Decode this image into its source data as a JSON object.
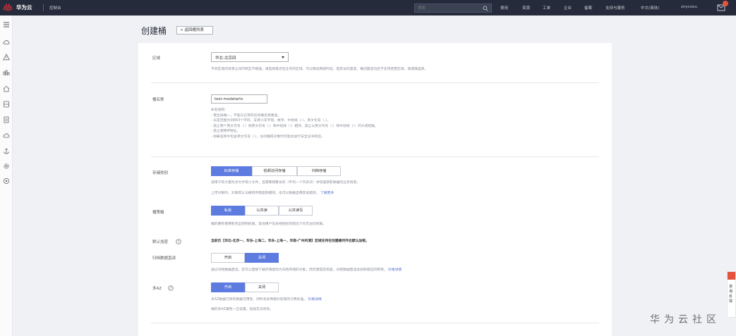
{
  "topbar": {
    "brand": "华为云",
    "console": "控制台",
    "search_placeholder": "搜索",
    "nav": [
      "费用",
      "资源",
      "工单",
      "企业",
      "备案",
      "支持与服务",
      "中文(简体)",
      "znycoou"
    ],
    "badge_color": "#e5533f"
  },
  "sidebar": {
    "icons": [
      "menu-icon",
      "cloud-icon",
      "warning-icon",
      "chart-icon",
      "home-icon",
      "storage-icon",
      "document-icon",
      "cloud-upload-icon",
      "anchor-icon",
      "settings-icon",
      "circle-icon"
    ]
  },
  "page": {
    "title": "创建桶",
    "back_label": "< 返回桶列表"
  },
  "form": {
    "region": {
      "label": "区域",
      "value": "华北-北京四",
      "help": "不同区域的资源之间内网互不相通。请选择靠近您业务的区域，可以降低网络时延、提高访问速度。桶创建成功后不支持变更区域，请谨慎选择。"
    },
    "bucket_name": {
      "label": "桶名称",
      "value": "test-modelarts",
      "help_lines": [
        "命名规则:",
        "- 需全局唯一，不能与已有的任何桶名称重复。",
        "- 长度范围为3到63个字符，支持小写字母、数字、中划线（-）、英文句号（.）。",
        "- 禁止两个英文句号（.）或英文句号（.）和中划线（-）相邻，禁止以英文句号（.）和中划线（-）开头或结尾。",
        "- 禁止使用IP地址。",
        "- 如果名称中包含英文句号（.），访问桶或对象时可能会进行安全证书校验。"
      ]
    },
    "storage_class": {
      "label": "存储类别",
      "options": [
        "标准存储",
        "低频访问存储",
        "归档存储"
      ],
      "selected": 0,
      "help": "适用于有大量热点文件或小文件，且需要频繁访问（平均一个月多次）并快速获取数据的业务场景。",
      "help2": "上传对象时，对象默认与桶的存储类别相同，也可以根据选用其他类别。",
      "help2_link": "了解更多"
    },
    "bucket_policy": {
      "label": "桶策略",
      "options": [
        "私有",
        "公共读",
        "公共读写"
      ],
      "selected": 0,
      "help": "桶的拥有者拥有完全控制权限，其他用户在未经授权的情况下均无访问权限。"
    },
    "default_encryption": {
      "label": "默认加密",
      "text": "当前仅【华北-北京一，华东-上海二，华东-上海一，华南-广州内测】区域支持在创建桶时开启默认加密。"
    },
    "archive_direct_read": {
      "label": "归档数据直读",
      "options": [
        "开启",
        "关闭"
      ],
      "selected": 1,
      "help": "通过归档数据直读，您可以直接下载存储类别为归档存储的对象，而无需提前恢复。归档数据直读会收取相应的费用。",
      "link": "价格详情"
    },
    "multi_az": {
      "label": "多AZ",
      "options": [
        "开启",
        "关闭"
      ],
      "selected": 0,
      "help": "多AZ数据冗余的数据可用性，同时会采用相对较高的计费标准。",
      "link": "价格详情",
      "help2": "桶的多AZ属性一旦设置，后续无法修改。"
    }
  },
  "float_tab": {
    "label": "咨询·反馈"
  },
  "watermark": "华为云社区",
  "colors": {
    "primary": "#5e7ce0",
    "topbar": "#252b3a",
    "link": "#526ecc"
  }
}
